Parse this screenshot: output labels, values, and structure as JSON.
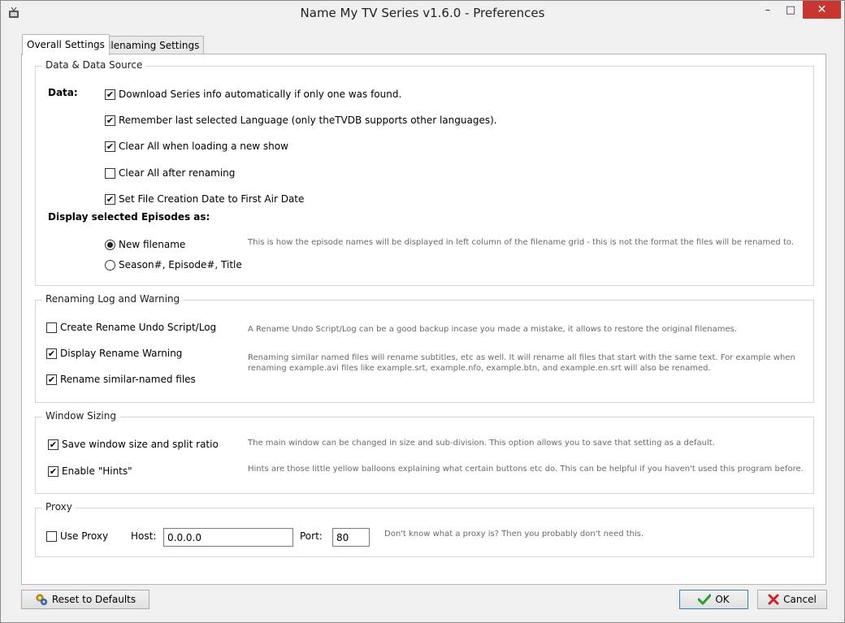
{
  "window": {
    "title": "Name My TV Series v1.6.0 - Preferences",
    "minimize": "–",
    "maximize": "□",
    "close": "✕"
  },
  "tabs": [
    {
      "label": "Overall Settings",
      "active": true
    },
    {
      "label": "Filenaming Settings",
      "active": false
    }
  ],
  "data_source": {
    "title": "Data & Data Source",
    "data_label": "Data:",
    "checks": [
      {
        "label": "Download Series info automatically if only one was found.",
        "checked": true
      },
      {
        "label": "Remember last selected Language (only theTVDB supports other languages).",
        "checked": true
      },
      {
        "label": "Clear All when loading a new show",
        "checked": true
      },
      {
        "label": "Clear All after renaming",
        "checked": false
      },
      {
        "label": "Set File Creation Date to First Air Date",
        "checked": true
      }
    ],
    "display_label": "Display selected Episodes as:",
    "radios": [
      {
        "label": "New filename",
        "selected": true
      },
      {
        "label": "Season#, Episode#, Title",
        "selected": false
      }
    ],
    "display_hint": "This is how the episode names will be displayed in left column of the filename grid - this is not the format the files will be renamed to."
  },
  "renaming": {
    "title": "Renaming Log and Warning",
    "checks": [
      {
        "label": "Create Rename Undo Script/Log",
        "checked": false
      },
      {
        "label": "Display Rename Warning",
        "checked": true
      },
      {
        "label": "Rename similar-named files",
        "checked": true
      }
    ],
    "undo_hint": "A Rename Undo Script/Log can be a good backup incase you made a mistake, it allows to restore the original filenames.",
    "similar_hint_1": "Renaming similar named files will rename subtitles, etc as well. It will rename all files that start with the same text. For example when",
    "similar_hint_2": "renaming example.avi files like example.srt, example.nfo, example.btn, and example.en.srt will also be renamed."
  },
  "window_sizing": {
    "title": "Window Sizing",
    "checks": [
      {
        "label": "Save window size and split ratio",
        "checked": true
      },
      {
        "label": "Enable \"Hints\"",
        "checked": true
      }
    ],
    "save_hint": "The main window can be changed in size and sub-division. This option allows you to save that setting as a default.",
    "hints_hint": "Hints are those little yellow balloons explaining what certain buttons etc do. This can be helpful if you haven't used this program before."
  },
  "proxy": {
    "title": "Proxy",
    "use_label": "Use Proxy",
    "use_checked": false,
    "host_label": "Host:",
    "host_value": "0.0.0.0",
    "port_label": "Port:",
    "port_value": "80",
    "hint": "Don't know what a proxy is? Then you probably don't need this."
  },
  "buttons": {
    "reset": "Reset to Defaults",
    "ok": "OK",
    "cancel": "Cancel"
  },
  "check_glyph": "✔"
}
